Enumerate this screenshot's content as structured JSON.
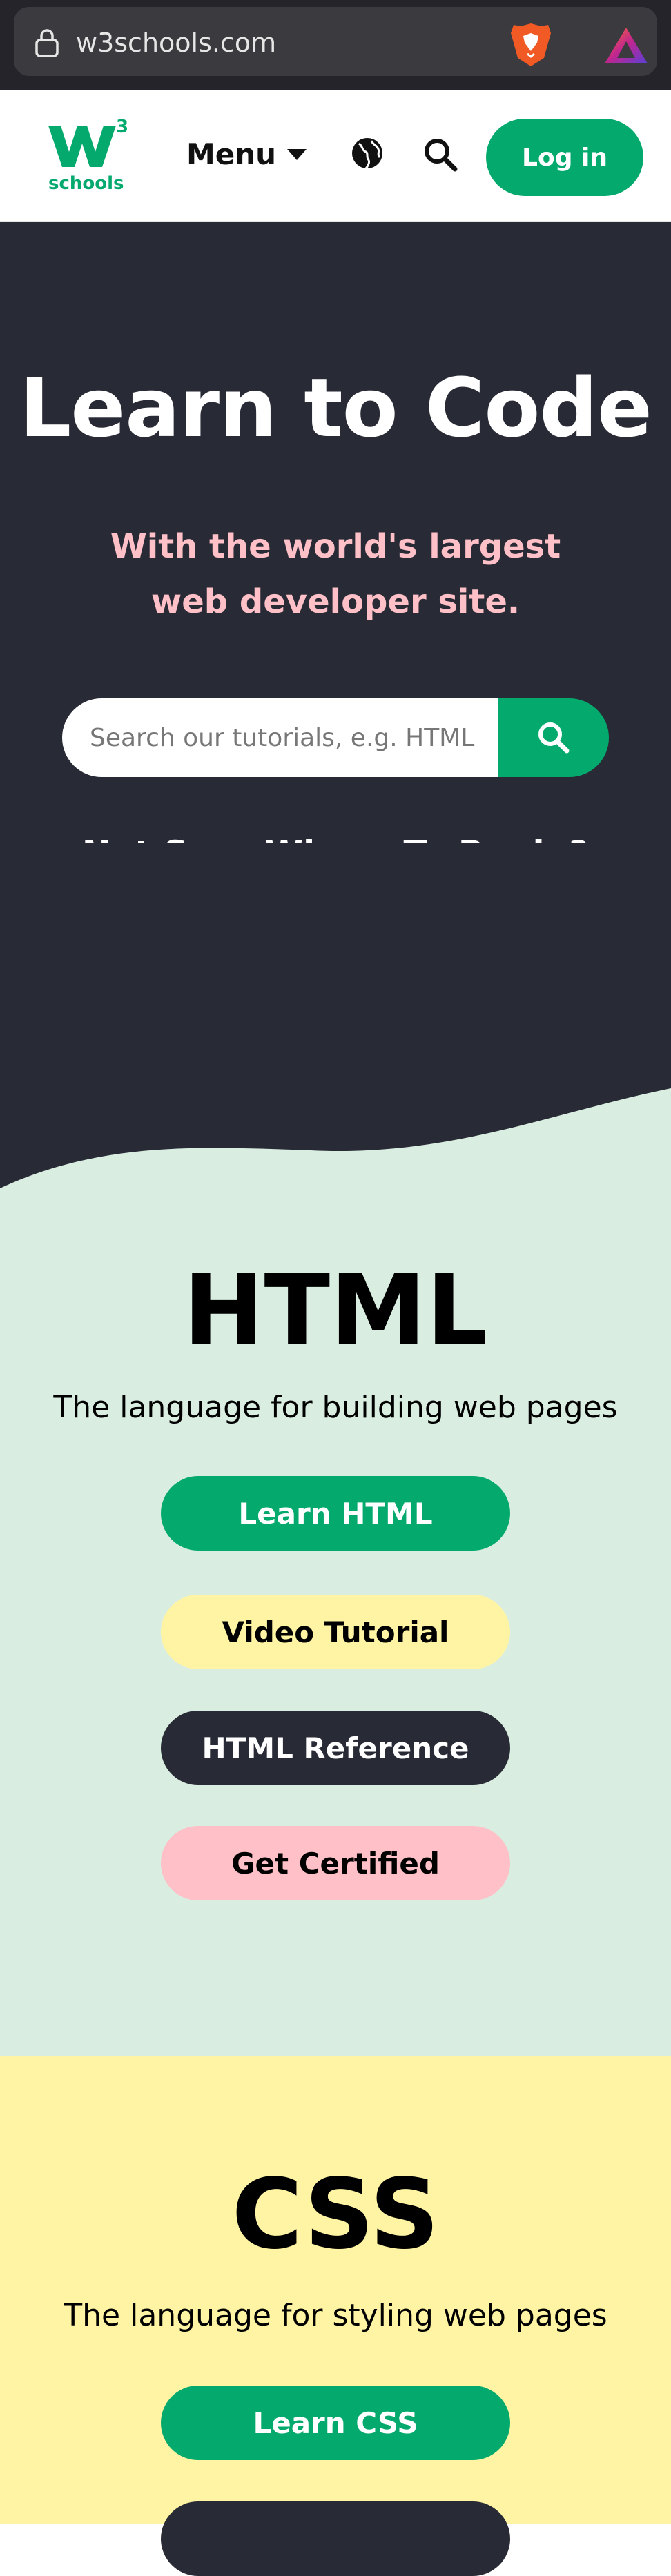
{
  "browser": {
    "url": "w3schools.com"
  },
  "header": {
    "logo_text": "schools",
    "logo_icon": "w3schools-logo",
    "menu_label": "Menu",
    "login_label": "Log in",
    "accent_color": "#04aa6d"
  },
  "hero": {
    "title": "Learn to Code",
    "subtitle": "With the world's largest web developer site.",
    "search_placeholder": "Search our tutorials, e.g. HTML",
    "not_sure": "Not Sure Where To Begin?",
    "background": "#282a35",
    "subtitle_color": "#ffc0c7"
  },
  "html_section": {
    "title": "HTML",
    "description": "The language for building web pages",
    "buttons": [
      {
        "label": "Learn HTML"
      },
      {
        "label": "Video Tutorial"
      },
      {
        "label": "HTML Reference"
      },
      {
        "label": "Get Certified"
      }
    ],
    "background": "#d9eee1"
  },
  "css_section": {
    "title": "CSS",
    "description": "The language for styling web pages",
    "buttons": [
      {
        "label": "Learn CSS"
      }
    ],
    "background": "#fff4a3"
  }
}
